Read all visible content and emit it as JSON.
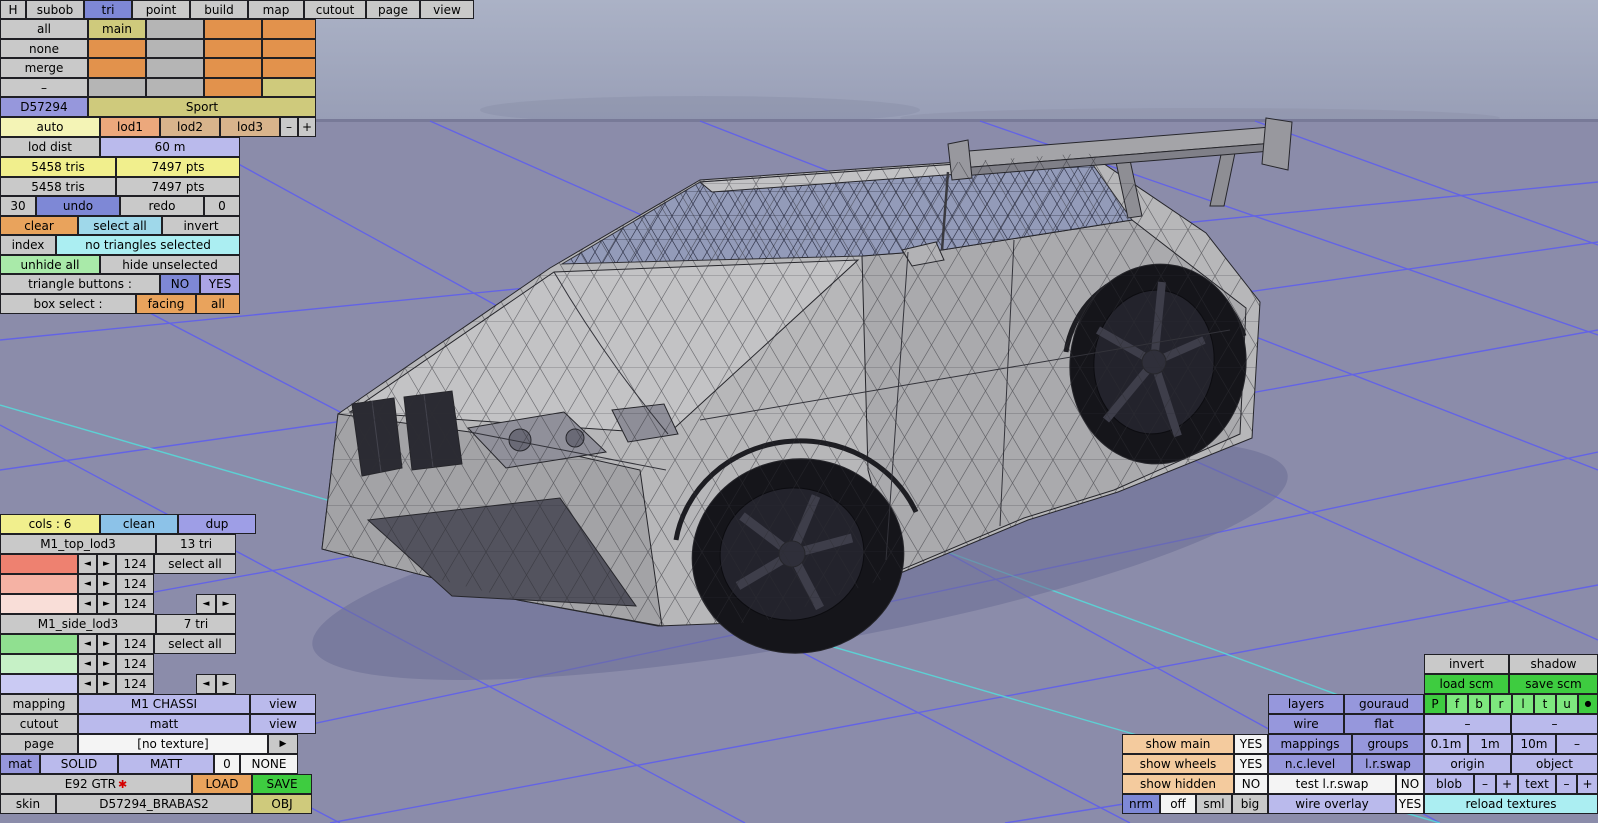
{
  "tabbar": {
    "h": "H",
    "subob": "subob",
    "tri": "tri",
    "point": "point",
    "build": "build",
    "map": "map",
    "cutout": "cutout",
    "page": "page",
    "view": "view"
  },
  "subob_grid": {
    "rows": [
      {
        "label": "all",
        "c1_text": "main",
        "c1": "#cfca7c",
        "c2": "#b5b5b5",
        "c3": "#e2924c",
        "c4": "#e2924c"
      },
      {
        "label": "none",
        "c1_text": "",
        "c1": "#e2924c",
        "c2": "#b5b5b5",
        "c3": "#e2924c",
        "c4": "#e2924c"
      },
      {
        "label": "merge",
        "c1_text": "",
        "c1": "#e2924c",
        "c2": "#b5b5b5",
        "c3": "#e2924c",
        "c4": "#e2924c"
      },
      {
        "label": "–",
        "c1_text": "",
        "c1": "#b5b5b5",
        "c2": "#b5b5b5",
        "c3": "#e2924c",
        "c4": "#cfca7c"
      }
    ]
  },
  "id_row": {
    "id": "D57294",
    "name": "Sport"
  },
  "lod": {
    "auto": "auto",
    "lod1": "lod1",
    "lod2": "lod2",
    "lod3": "lod3",
    "minus": "–",
    "plus": "+",
    "dist_label": "lod dist",
    "dist_value": "60 m"
  },
  "stats": {
    "tris_a": "5458 tris",
    "pts_a": "7497 pts",
    "tris_b": "5458 tris",
    "pts_b": "7497 pts",
    "undo_steps": "30",
    "undo": "undo",
    "redo": "redo",
    "redo_steps": "0"
  },
  "selection": {
    "clear": "clear",
    "select_all": "select all",
    "invert": "invert",
    "index": "index",
    "status": "no triangles selected",
    "unhide_all": "unhide all",
    "hide_unselected": "hide unselected",
    "triangle_buttons_label": "triangle buttons :",
    "no": "NO",
    "yes": "YES",
    "box_select_label": "box select :",
    "facing": "facing",
    "all": "all"
  },
  "cols": {
    "header": "cols : 6",
    "clean": "clean",
    "dup": "dup",
    "select_all": "select all",
    "prev": "◄",
    "next": "►",
    "groups": [
      {
        "name": "M1_top_lod3",
        "tri_count": "13 tri",
        "rows": [
          {
            "swatch": "#ee8170",
            "value": "124"
          },
          {
            "swatch": "#f5b2a4",
            "value": "124"
          },
          {
            "swatch": "#f9ded8",
            "value": "124"
          }
        ]
      },
      {
        "name": "M1_side_lod3",
        "tri_count": "7 tri",
        "rows": [
          {
            "swatch": "#90e090",
            "value": "124"
          },
          {
            "swatch": "#c6f1c6",
            "value": "124"
          },
          {
            "swatch": "#cacaf3",
            "value": "124"
          }
        ]
      }
    ]
  },
  "mapping": {
    "mapping_label": "mapping",
    "mapping_value": "M1 CHASSI",
    "view": "view",
    "cutout_label": "cutout",
    "cutout_value": "matt",
    "page_label": "page",
    "page_value": "[no texture]",
    "page_next": "▶",
    "mat_label": "mat",
    "solid": "SOLID",
    "matt": "MATT",
    "zero": "0",
    "none": "NONE",
    "model_name": "E92 GTR",
    "star": "✱",
    "load": "LOAD",
    "save": "SAVE",
    "skin_label": "skin",
    "skin_value": "D57294_BRABAS2",
    "obj": "OBJ"
  },
  "scm": {
    "invert": "invert",
    "shadow": "shadow",
    "load_scm": "load scm",
    "save_scm": "save scm"
  },
  "render": {
    "layers": "layers",
    "gouraud": "gouraud",
    "flags": [
      "P",
      "f",
      "b",
      "r",
      "l",
      "t",
      "u"
    ],
    "dot": "●",
    "wire": "wire",
    "flat": "flat",
    "dash_a": "–",
    "dash_b": "–"
  },
  "show": {
    "main_label": "show main",
    "main_value": "YES",
    "wheels_label": "show wheels",
    "wheels_value": "YES",
    "hidden_label": "show hidden",
    "hidden_value": "NO",
    "nrm": "nrm",
    "off": "off",
    "sml": "sml",
    "big": "big"
  },
  "tools": {
    "mappings": "mappings",
    "groups": "groups",
    "m01": "0.1m",
    "m1": "1m",
    "m10": "10m",
    "mdash": "–",
    "nc_level": "n.c.level",
    "lr_swap": "l.r.swap",
    "origin": "origin",
    "object": "object",
    "test_lr_swap": "test l.r.swap",
    "test_value": "NO",
    "blob": "blob",
    "blob_minus": "–",
    "blob_plus": "+",
    "text": "text",
    "text_minus": "–",
    "text_plus": "+",
    "wire_overlay": "wire overlay",
    "wire_overlay_value": "YES",
    "reload_textures": "reload textures"
  },
  "viewport_colors": {
    "sky": "#a8afc3",
    "ground": "#8b8caa",
    "grid_blue": "#5d5df0",
    "grid_cyan": "#57d9d9",
    "car_body": "#b7b7b9"
  }
}
